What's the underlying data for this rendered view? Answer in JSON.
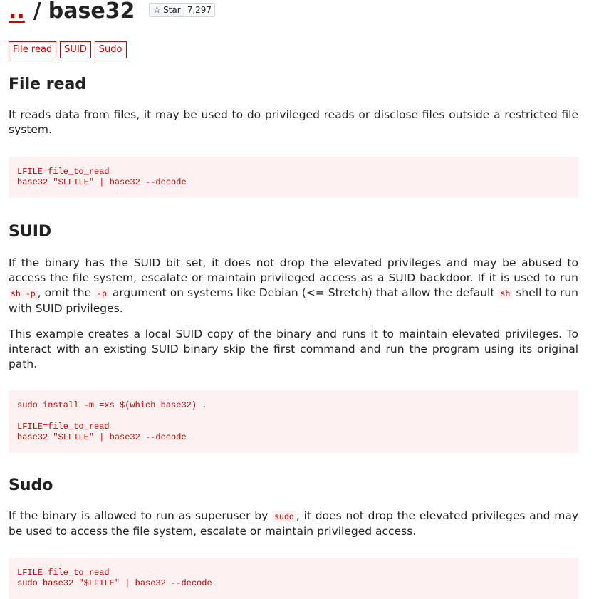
{
  "header": {
    "up_link": "..",
    "separator": "/",
    "title": "base32",
    "star_label": "Star",
    "star_count": "7,297"
  },
  "tags": [
    "File read",
    "SUID",
    "Sudo"
  ],
  "file_read": {
    "heading": "File read",
    "text": "It reads data from files, it may be used to do privileged reads or disclose files outside a restricted file system.",
    "code": "LFILE=file_to_read\nbase32 \"$LFILE\" | base32 --decode"
  },
  "suid": {
    "heading": "SUID",
    "p1_part1": "If the binary has the SUID bit set, it does not drop the elevated privileges and may be abused to access the file system, escalate or maintain privileged access as a SUID backdoor. If it is used to run ",
    "p1_code1": "sh -p",
    "p1_part2": ", omit the ",
    "p1_code2": "-p",
    "p1_part3": " argument on systems like Debian (<= Stretch) that allow the default ",
    "p1_code3": "sh",
    "p1_part4": " shell to run with SUID privileges.",
    "p2": "This example creates a local SUID copy of the binary and runs it to maintain elevated privileges. To interact with an existing SUID binary skip the first command and run the program using its original path.",
    "code": "sudo install -m =xs $(which base32) .\n\nLFILE=file_to_read\nbase32 \"$LFILE\" | base32 --decode"
  },
  "sudo": {
    "heading": "Sudo",
    "p1_part1": "If the binary is allowed to run as superuser by ",
    "p1_code": "sudo",
    "p1_part2": ", it does not drop the elevated privileges and may be used to access the file system, escalate or maintain privileged access.",
    "code": "LFILE=file_to_read\nsudo base32 \"$LFILE\" | base32 --decode"
  }
}
